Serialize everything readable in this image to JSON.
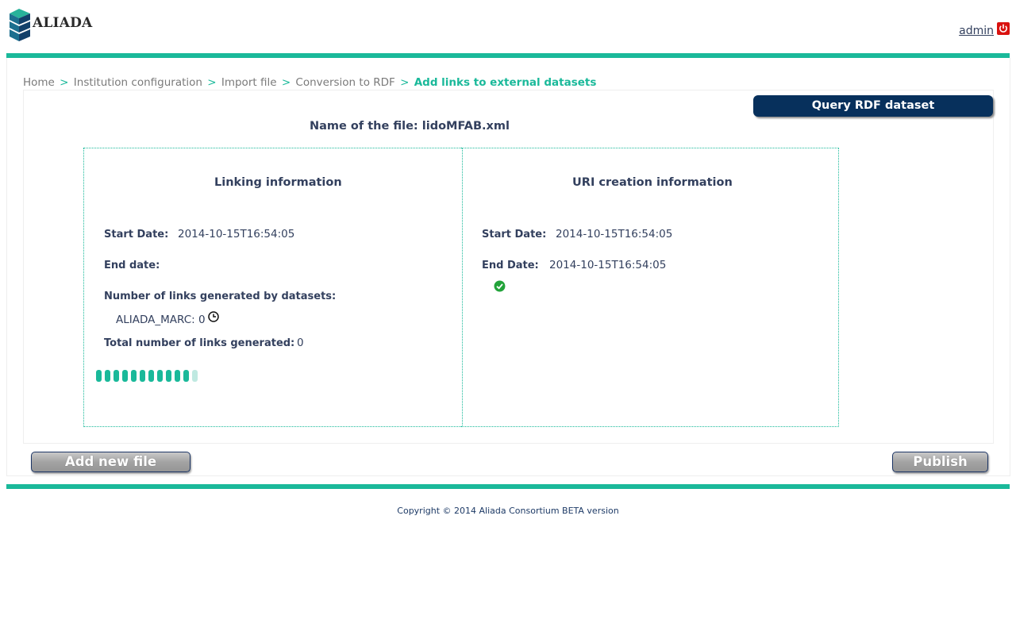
{
  "header": {
    "logo_text": "ALIADA",
    "user_link": "admin",
    "logout_icon": "power-icon"
  },
  "breadcrumb": {
    "items": [
      "Home",
      "Institution configuration",
      "Import file",
      "Conversion to RDF"
    ],
    "current": "Add links to external datasets",
    "separator": ">"
  },
  "toolbar": {
    "query_label": "Query RDF dataset"
  },
  "file": {
    "title": "Name of the file: lidoMFAB.xml"
  },
  "linking": {
    "title": "Linking information",
    "start_label": "Start Date:",
    "start_value": "2014-10-15T16:54:05",
    "end_label": "End date:",
    "end_value": "",
    "by_datasets_label": "Number of links generated by datasets:",
    "dataset_line": "ALIADA_MARC: 0",
    "dataset_status_icon": "clock-icon",
    "total_label": "Total number of links generated:",
    "total_value": "0",
    "progress_total_segments": 12,
    "progress_filled_segments": 11
  },
  "uri": {
    "title": "URI creation information",
    "start_label": "Start Date:",
    "start_value": "2014-10-15T16:54:05",
    "end_label": "End Date:",
    "end_value": "2014-10-15T16:54:05",
    "status_icon": "check-icon"
  },
  "actions": {
    "add_new_file": "Add new file",
    "publish": "Publish"
  },
  "footer": {
    "copyright": "Copyright © 2014 Aliada Consortium BETA version"
  },
  "colors": {
    "accent": "#1ab99a",
    "dark_button": "#07305c",
    "text": "#33405e"
  }
}
